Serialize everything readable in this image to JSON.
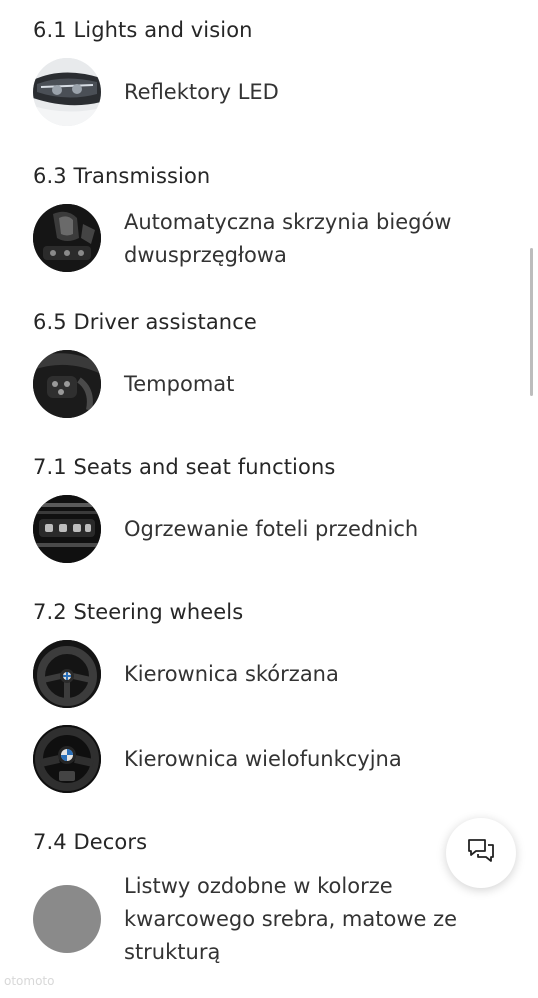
{
  "sections": [
    {
      "heading": "6.1 Lights and vision",
      "items": [
        {
          "label": "Reflektory LED",
          "icon": "headlight-thumbnail"
        }
      ]
    },
    {
      "heading": "6.3 Transmission",
      "items": [
        {
          "label": "Automatyczna skrzynia biegów dwusprzęgłowa",
          "icon": "gear-selector-thumbnail"
        }
      ]
    },
    {
      "heading": "6.5 Driver assistance",
      "items": [
        {
          "label": "Tempomat",
          "icon": "steering-controls-thumbnail"
        }
      ]
    },
    {
      "heading": "7.1 Seats and seat functions",
      "items": [
        {
          "label": "Ogrzewanie foteli przednich",
          "icon": "seat-heating-thumbnail"
        }
      ]
    },
    {
      "heading": "7.2 Steering wheels",
      "items": [
        {
          "label": "Kierownica skórzana",
          "icon": "leather-steering-wheel-thumbnail"
        },
        {
          "label": "Kierownica wielofunkcyjna",
          "icon": "multifunction-steering-wheel-thumbnail"
        }
      ]
    },
    {
      "heading": "7.4 Decors",
      "items": [
        {
          "label": "Listwy ozdobne w kolorze kwarcowego srebra, matowe ze strukturą",
          "icon": "trim-color-swatch"
        }
      ]
    }
  ],
  "chat_button": {
    "icon": "chat-bubbles-icon"
  },
  "watermark": "otomoto",
  "colors": {
    "text": "#262626",
    "swatch": "#8a8a8a",
    "background": "#ffffff"
  }
}
